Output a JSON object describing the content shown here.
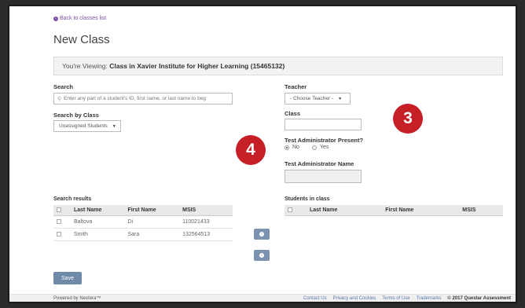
{
  "nav": {
    "back_label": "Back to classes list"
  },
  "page": {
    "title": "New Class"
  },
  "viewing": {
    "prefix": "You're Viewing:",
    "value": "Class in Xavier Institute for Higher Learning (15465132)"
  },
  "search": {
    "label": "Search",
    "placeholder": "Enter any part of a student's ID, first name, or last name to beg",
    "by_class_label": "Search by Class",
    "by_class_value": "Unassigned Students"
  },
  "teacher": {
    "label": "Teacher",
    "value": "- Choose Teacher -"
  },
  "class_field": {
    "label": "Class",
    "value": ""
  },
  "test_admin": {
    "present_label": "Test Administrator Present?",
    "options": [
      "No",
      "Yes"
    ],
    "selected": "No",
    "name_label": "Test Administrator Name",
    "name_value": ""
  },
  "search_results": {
    "title": "Search results",
    "columns": [
      "Last Name",
      "First Name",
      "MSIS"
    ],
    "rows": [
      {
        "last": "Baltova",
        "first": "Di",
        "msis": "110021433"
      },
      {
        "last": "Smith",
        "first": "Sara",
        "msis": "132564513"
      }
    ]
  },
  "students_in_class": {
    "title": "Students in class",
    "columns": [
      "Last Name",
      "First Name",
      "MSIS"
    ]
  },
  "buttons": {
    "save_label": "Save"
  },
  "badges": {
    "three": "3",
    "four": "4"
  },
  "footer": {
    "powered": "Powered by Nextera™",
    "links": [
      "Contact Us",
      "Privacy and Cookies",
      "Terms of Use",
      "Trademarks"
    ],
    "copyright": "© 2017 Questar Assessment"
  },
  "colors": {
    "accent": "#7a4fa3",
    "button": "#6f8aa9",
    "badge": "#c62026"
  }
}
